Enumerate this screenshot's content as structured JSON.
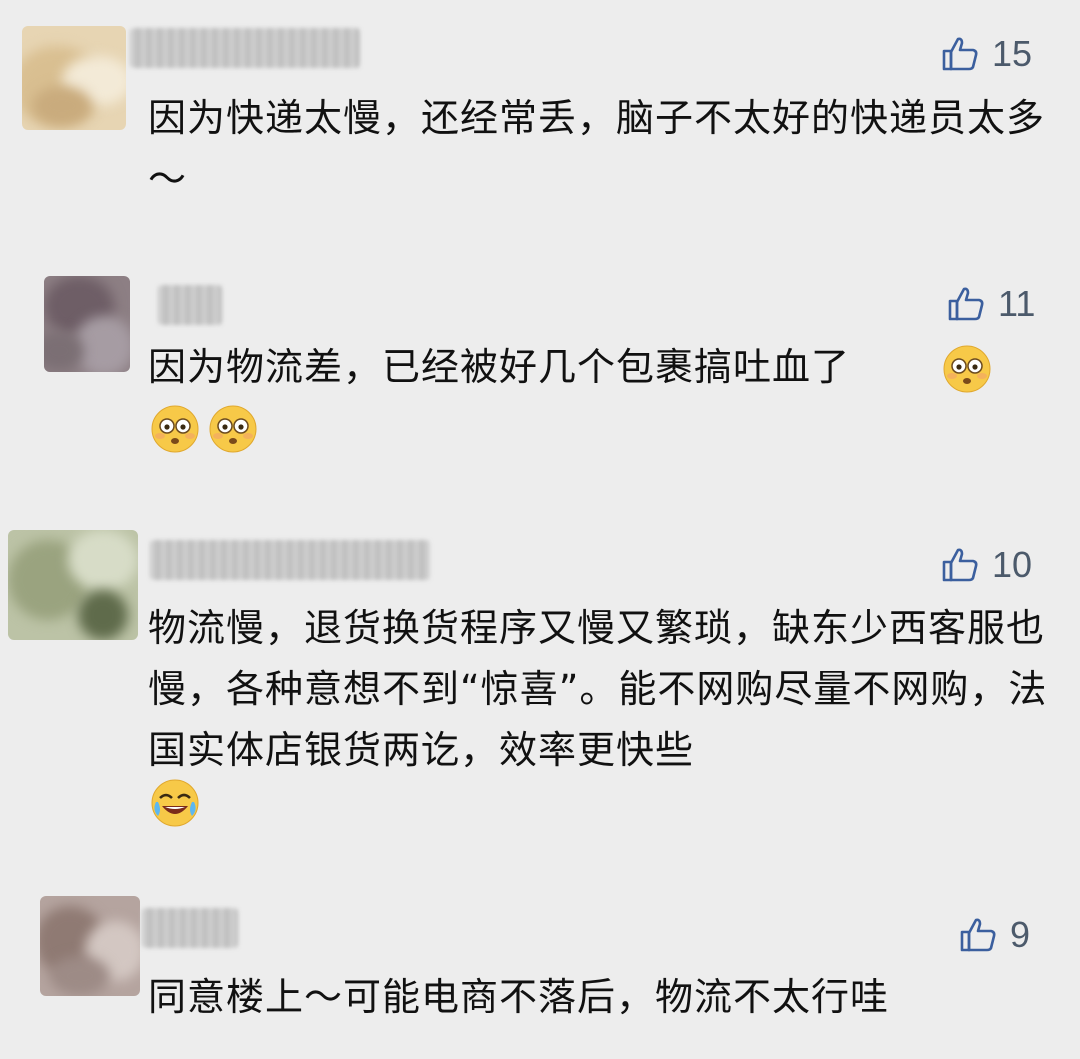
{
  "comments": [
    {
      "likes": "15",
      "text": "因为快递太慢，还经常丢，脑子不太好的快递员太多～",
      "emojis": []
    },
    {
      "likes": "11",
      "text": "因为物流差，已经被好几个包裹搞吐血了",
      "emojis": [
        "flushed-face",
        "flushed-face",
        "flushed-face"
      ]
    },
    {
      "likes": "10",
      "text": "物流慢，退货换货程序又慢又繁琐，缺东少西客服也慢，各种意想不到“惊喜”。能不网购尽量不网购，法国实体店银货两讫，效率更快些",
      "emojis": [
        "rolling-on-floor-laughing"
      ]
    },
    {
      "likes": "9",
      "text": "同意楼上～可能电商不落后，物流不太行哇",
      "emojis": []
    }
  ],
  "colors": {
    "background": "#ededed",
    "like_count": "#4c5a6b",
    "thumb_outline": "#3b5f9e",
    "text": "#111111"
  },
  "icons": {
    "like": "thumbs-up-icon"
  }
}
